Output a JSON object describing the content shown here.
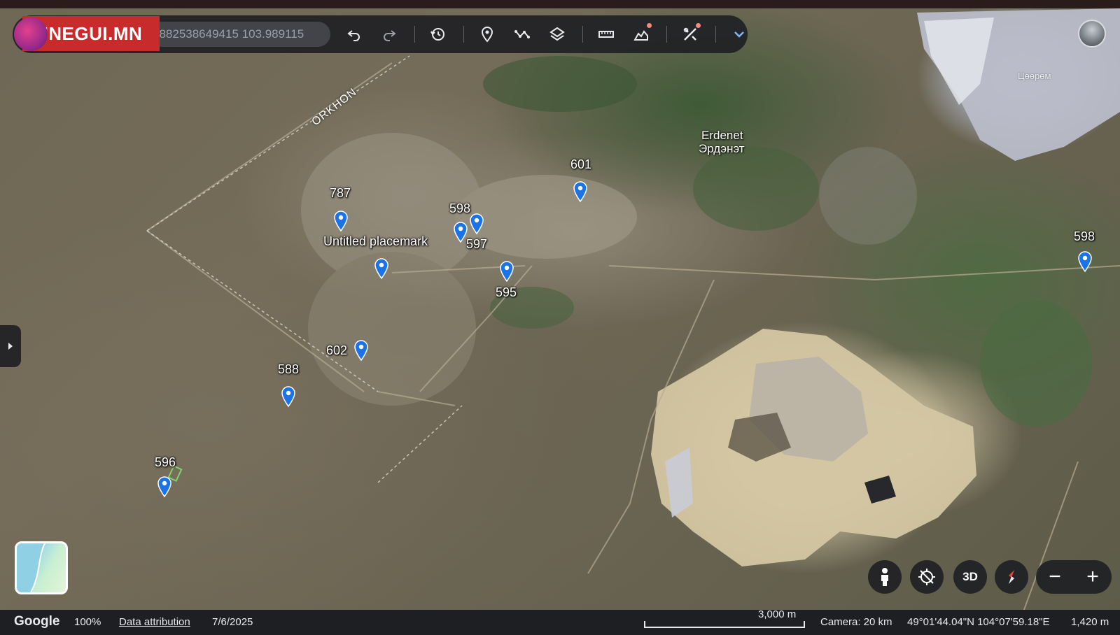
{
  "brand": {
    "text": "UNEGUI.MN"
  },
  "toolbar": {
    "coordinates_value": "3882538649415 103.989115",
    "buttons": [
      {
        "name": "undo-icon"
      },
      {
        "name": "redo-icon"
      },
      {
        "name": "history-icon"
      },
      {
        "name": "add-placemark-icon"
      },
      {
        "name": "add-path-icon"
      },
      {
        "name": "layers-icon"
      },
      {
        "name": "measure-icon"
      },
      {
        "name": "elevation-icon"
      },
      {
        "name": "tools-icon"
      },
      {
        "name": "chevron-down-icon"
      }
    ]
  },
  "map": {
    "region_label": "ORKHON",
    "city_name_latin": "Erdenet",
    "city_name_cyrillic": "Эрдэнэт",
    "lake_label": "Цөөрөм",
    "placemarks": [
      {
        "label": "787"
      },
      {
        "label": "598"
      },
      {
        "label": "597"
      },
      {
        "label": "601"
      },
      {
        "label": "Untitled placemark"
      },
      {
        "label": "595"
      },
      {
        "label": "602"
      },
      {
        "label": "588"
      },
      {
        "label": "596"
      },
      {
        "label": "598"
      }
    ]
  },
  "controls": {
    "view_3d_label": "3D",
    "zoom_out_label": "−",
    "zoom_in_label": "+"
  },
  "status": {
    "logo": "Google",
    "zoom": "100%",
    "attribution": "Data attribution",
    "date": "7/6/2025",
    "scale": "3,000 m",
    "camera": "Camera: 20 km",
    "coords": "49°01'44.04\"N 104°07'59.18\"E",
    "elevation": "1,420 m"
  },
  "colors": {
    "toolbar_bg": "#202124",
    "brand_red": "#c72b2b",
    "placemark_blue": "#1a73e8",
    "notification_dot": "#f28b82"
  }
}
